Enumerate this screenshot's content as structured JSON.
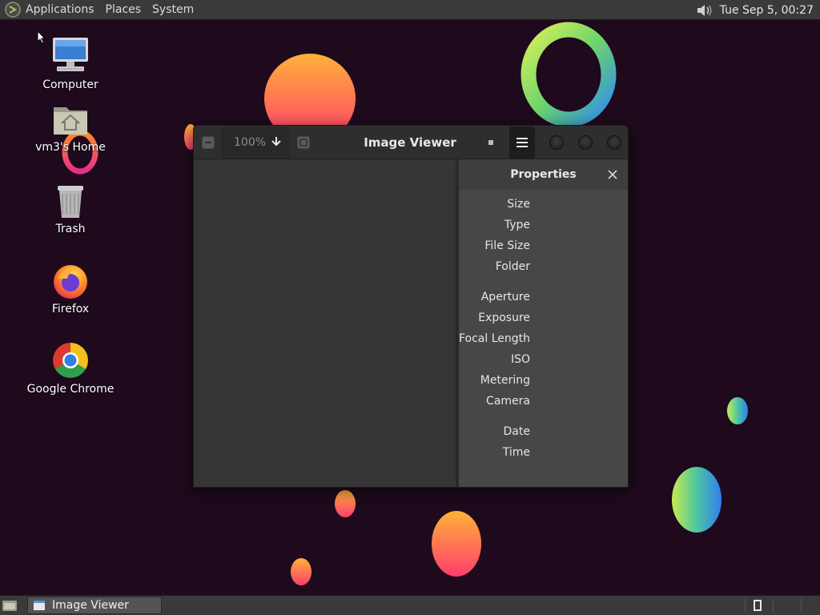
{
  "top_panel": {
    "menus": [
      "Applications",
      "Places",
      "System"
    ],
    "clock": "Tue Sep  5, 00:27"
  },
  "desktop": {
    "icons": [
      {
        "label": "Computer"
      },
      {
        "label": "vm3's Home"
      },
      {
        "label": "Trash"
      },
      {
        "label": "Firefox"
      },
      {
        "label": "Google Chrome"
      }
    ]
  },
  "window": {
    "title": "Image Viewer",
    "zoom": "100%",
    "properties": {
      "title": "Properties",
      "groups": [
        [
          "Size",
          "Type",
          "File Size",
          "Folder"
        ],
        [
          "Aperture",
          "Exposure",
          "Focal Length",
          "ISO",
          "Metering",
          "Camera"
        ],
        [
          "Date",
          "Time"
        ]
      ]
    }
  },
  "taskbar": {
    "tasks": [
      {
        "label": "Image Viewer"
      }
    ]
  },
  "colors": {
    "desktop_bg": "#1e0a1c",
    "panel": "#3a3a3a",
    "window_bg": "#353535",
    "properties_bg": "#474747"
  }
}
